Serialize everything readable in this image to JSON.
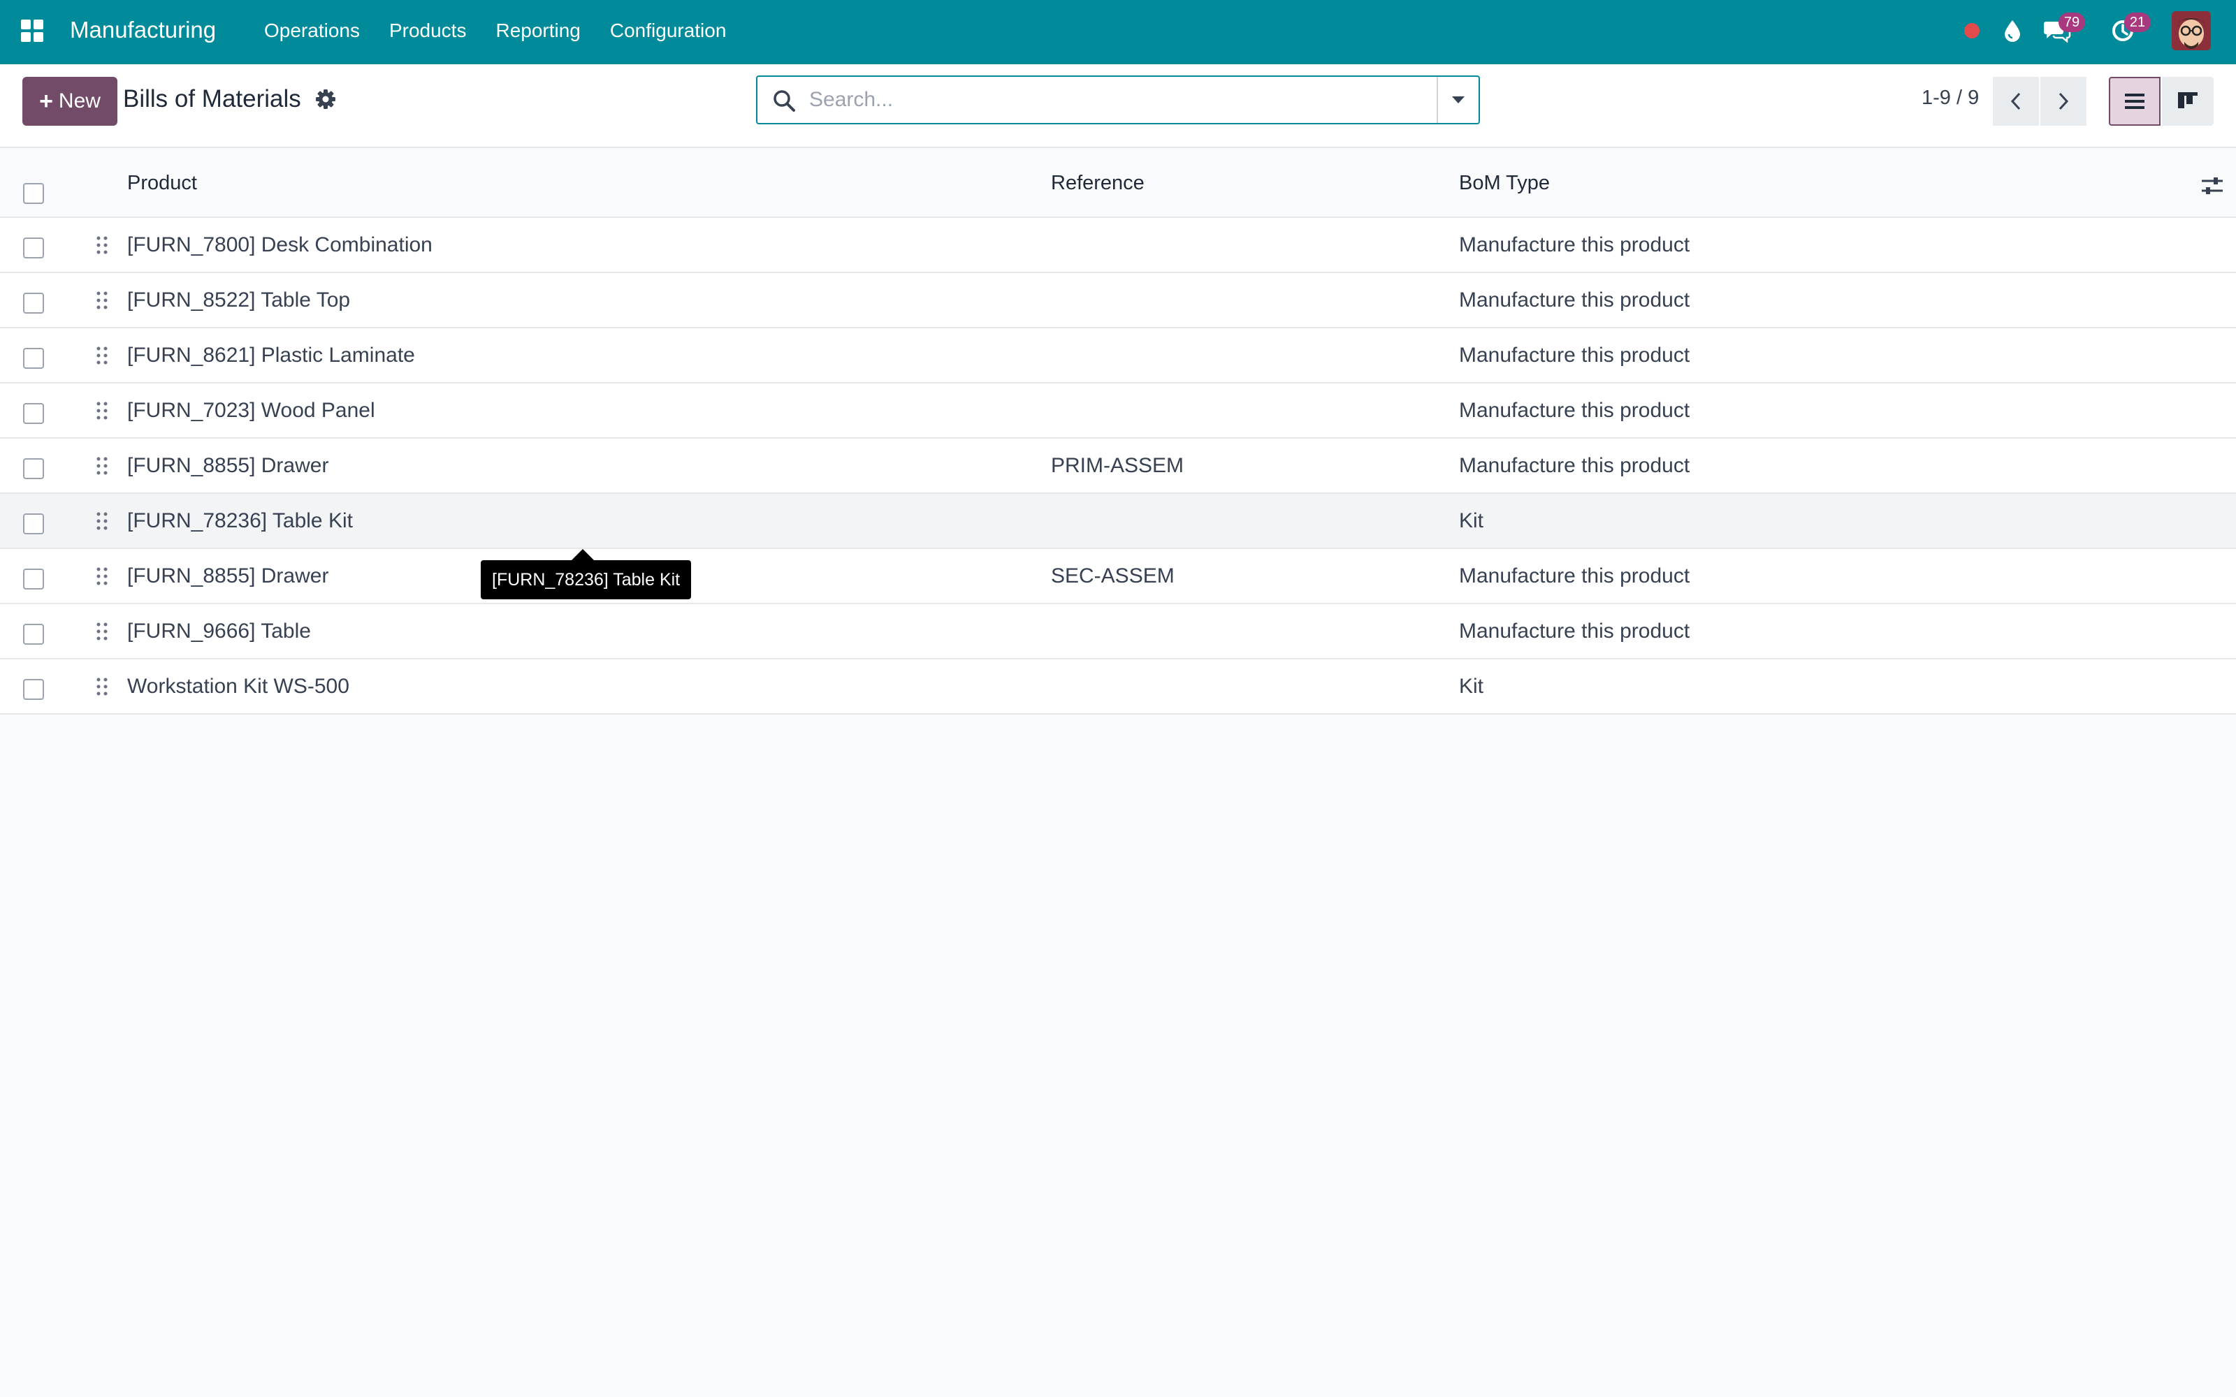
{
  "nav": {
    "app_name": "Manufacturing",
    "menu": [
      "Operations",
      "Products",
      "Reporting",
      "Configuration"
    ],
    "messages_count": "79",
    "activities_count": "21",
    "accent_color": "#018a99",
    "icons": [
      "apps-grid-icon",
      "record-dot-icon",
      "droplet-icon",
      "chat-icon",
      "clock-icon",
      "avatar"
    ]
  },
  "control": {
    "new_label": "New",
    "title": "Bills of Materials",
    "search_placeholder": "Search...",
    "pager": "1-9 / 9",
    "primary_color": "#714b67"
  },
  "table": {
    "columns": [
      "Product",
      "Reference",
      "BoM Type"
    ],
    "rows": [
      {
        "product": "[FURN_7800] Desk Combination",
        "reference": "",
        "type": "Manufacture this product"
      },
      {
        "product": "[FURN_8522] Table Top",
        "reference": "",
        "type": "Manufacture this product"
      },
      {
        "product": "[FURN_8621] Plastic Laminate",
        "reference": "",
        "type": "Manufacture this product"
      },
      {
        "product": "[FURN_7023] Wood Panel",
        "reference": "",
        "type": "Manufacture this product"
      },
      {
        "product": "[FURN_8855] Drawer",
        "reference": "PRIM-ASSEM",
        "type": "Manufacture this product"
      },
      {
        "product": "[FURN_78236] Table Kit",
        "reference": "",
        "type": "Kit"
      },
      {
        "product": "[FURN_8855] Drawer",
        "reference": "SEC-ASSEM",
        "type": "Manufacture this product"
      },
      {
        "product": "[FURN_9666] Table",
        "reference": "",
        "type": "Manufacture this product"
      },
      {
        "product": "Workstation Kit WS-500",
        "reference": "",
        "type": "Kit"
      }
    ]
  },
  "tooltip": {
    "text": "[FURN_78236] Table Kit"
  }
}
